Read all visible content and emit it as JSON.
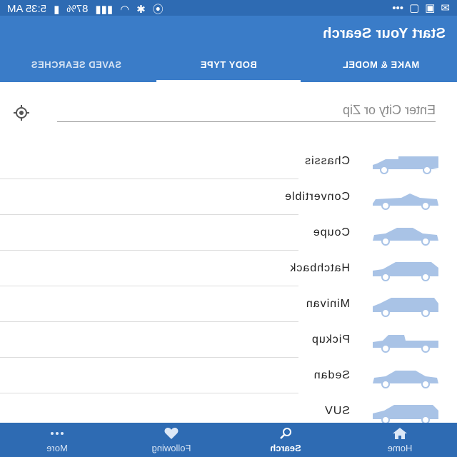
{
  "status_bar": {
    "time": "5:35 AM",
    "battery": "87%"
  },
  "header": {
    "title": "Start Your Search"
  },
  "tabs": [
    {
      "label": "MAKE & MODEL"
    },
    {
      "label": "BODY TYPE"
    },
    {
      "label": "SAVED SEARCHES"
    }
  ],
  "search": {
    "placeholder": "Enter City or Zip",
    "value": ""
  },
  "body_types": [
    {
      "label": "Chassis",
      "icon": "chassis-truck-icon"
    },
    {
      "label": "Convertible",
      "icon": "convertible-car-icon"
    },
    {
      "label": "Coupe",
      "icon": "coupe-car-icon"
    },
    {
      "label": "Hatchback",
      "icon": "hatchback-car-icon"
    },
    {
      "label": "Minivan",
      "icon": "minivan-icon"
    },
    {
      "label": "Pickup",
      "icon": "pickup-truck-icon"
    },
    {
      "label": "Sedan",
      "icon": "sedan-car-icon"
    },
    {
      "label": "SUV",
      "icon": "suv-car-icon"
    }
  ],
  "bottom_nav": [
    {
      "label": "Home",
      "icon": "home-icon"
    },
    {
      "label": "Search",
      "icon": "search-icon"
    },
    {
      "label": "Following",
      "icon": "heart-icon"
    },
    {
      "label": "More",
      "icon": "more-dots-icon"
    }
  ],
  "colors": {
    "primary": "#3a7cc8",
    "status": "#2e6bb3",
    "car_icon": "#a9c3e6"
  }
}
